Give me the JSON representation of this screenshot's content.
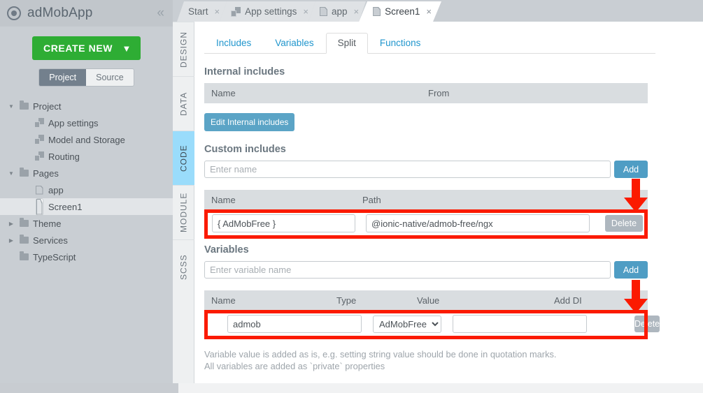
{
  "app": {
    "title": "adMobApp",
    "logo_icon": "target-circle-icon",
    "collapse_icon": "chevron-double-left-icon"
  },
  "sidebar": {
    "create_new_label": "CREATE NEW",
    "create_new_icon": "chevron-down-icon",
    "segments": [
      {
        "label": "Project",
        "active": true
      },
      {
        "label": "Source",
        "active": false
      }
    ],
    "tree": [
      {
        "label": "Project",
        "icon": "folder-icon",
        "twisty": "open",
        "indent": 1,
        "selected": false
      },
      {
        "label": "App settings",
        "icon": "multi-page-icon",
        "twisty": "none",
        "indent": 2,
        "selected": false
      },
      {
        "label": "Model and Storage",
        "icon": "multi-page-icon",
        "twisty": "none",
        "indent": 2,
        "selected": false
      },
      {
        "label": "Routing",
        "icon": "multi-page-icon",
        "twisty": "none",
        "indent": 2,
        "selected": false
      },
      {
        "label": "Pages",
        "icon": "folder-icon",
        "twisty": "open",
        "indent": 1,
        "selected": false
      },
      {
        "label": "app",
        "icon": "page-icon",
        "twisty": "none",
        "indent": 2,
        "selected": false
      },
      {
        "label": "Screen1",
        "icon": "page-icon",
        "twisty": "none",
        "indent": 2,
        "selected": true
      },
      {
        "label": "Theme",
        "icon": "folder-icon",
        "twisty": "closed",
        "indent": 1,
        "selected": false
      },
      {
        "label": "Services",
        "icon": "folder-icon",
        "twisty": "closed",
        "indent": 1,
        "selected": false
      },
      {
        "label": "TypeScript",
        "icon": "folder-icon",
        "twisty": "none",
        "indent": 1,
        "selected": false
      }
    ]
  },
  "tabbar": {
    "tabs": [
      {
        "label": "Start",
        "icon": "none",
        "active": false,
        "close_icon": "×"
      },
      {
        "label": "App settings",
        "icon": "multi-page-icon",
        "active": false,
        "close_icon": "×"
      },
      {
        "label": "app",
        "icon": "page-icon",
        "active": false,
        "close_icon": "×"
      },
      {
        "label": "Screen1",
        "icon": "page-icon",
        "active": true,
        "close_icon": "×"
      }
    ]
  },
  "vertical_tabs": [
    {
      "label": "DESIGN",
      "active": false
    },
    {
      "label": "DATA",
      "active": false
    },
    {
      "label": "CODE",
      "active": true
    },
    {
      "label": "MODULE",
      "active": false
    },
    {
      "label": "SCSS",
      "active": false
    }
  ],
  "subtabs": [
    {
      "label": "Includes",
      "active": false
    },
    {
      "label": "Variables",
      "active": false
    },
    {
      "label": "Split",
      "active": true
    },
    {
      "label": "Functions",
      "active": false
    }
  ],
  "internal_includes": {
    "title": "Internal includes",
    "columns": [
      "Name",
      "From"
    ],
    "rows": [],
    "edit_button": "Edit Internal includes"
  },
  "custom_includes": {
    "title": "Custom includes",
    "name_placeholder": "Enter name",
    "name_value": "",
    "add_label": "Add",
    "columns": [
      "Name",
      "Path"
    ],
    "rows": [
      {
        "name": "{ AdMobFree }",
        "path": "@ionic-native/admob-free/ngx",
        "delete_label": "Delete"
      }
    ]
  },
  "variables": {
    "title": "Variables",
    "name_placeholder": "Enter variable name",
    "name_value": "",
    "add_label": "Add",
    "columns": [
      "Name",
      "Type",
      "Value",
      "Add DI"
    ],
    "rows": [
      {
        "name": "admob",
        "type": "AdMobFree",
        "type_options": [
          "AdMobFree"
        ],
        "value": "",
        "add_di": true,
        "delete_label": "Delete"
      }
    ]
  },
  "notes": {
    "line1": "Variable value is added as is, e.g. setting string value should be done in quotation marks.",
    "line2": "All variables are added as `private` properties"
  },
  "annotations": {
    "highlight_color": "#fb1a00",
    "arrow_icon": "down-arrow-icon",
    "count": 2
  },
  "colors": {
    "accent_green": "#2ead34",
    "accent_blue": "#4f9dc4",
    "link_blue": "#2196cd",
    "active_vtab": "#9adcfb",
    "sidebar_bg": "#c9ced3",
    "checkbox_blue": "#1a8cf0",
    "annotation_red": "#fb1a00"
  }
}
